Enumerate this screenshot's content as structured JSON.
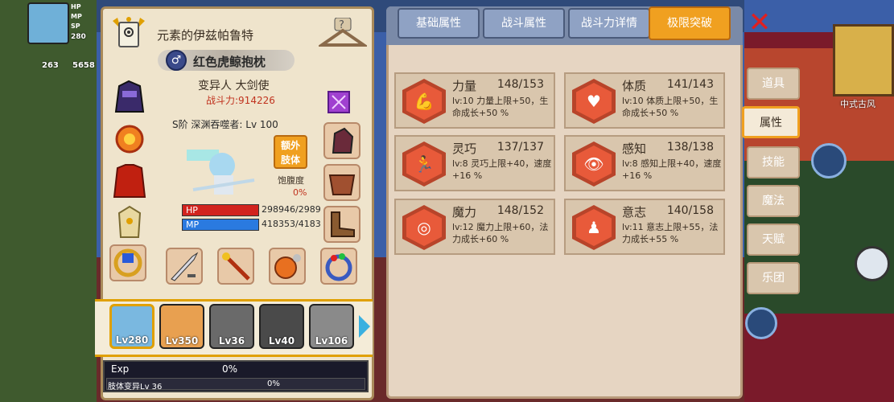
{
  "hud": {
    "hp_label": "HP",
    "mp_label": "MP",
    "sp_label": "SP",
    "level": "280",
    "count1": "263",
    "count2": "5658"
  },
  "header": {
    "title": "元素的伊兹帕鲁特"
  },
  "item": {
    "gender_symbol": "♂",
    "name": "红色虎鲸抱枕"
  },
  "character": {
    "class": "变异人 大剑使",
    "power": "战斗力:914226",
    "rank": "S阶 深渊吞噬者: Lv 100"
  },
  "extra_limb": {
    "label_line1": "额外",
    "label_line2": "肢体"
  },
  "satiety": {
    "label": "饱腹度",
    "value": "0%"
  },
  "bars": {
    "hp_label": "HP",
    "hp_value": "298946/2989",
    "mp_label": "MP",
    "mp_value": "418353/4183"
  },
  "party": [
    {
      "level": "Lv280",
      "selected": true
    },
    {
      "level": "Lv350",
      "selected": false
    },
    {
      "level": "Lv36",
      "selected": false
    },
    {
      "level": "Lv40",
      "selected": false
    },
    {
      "level": "Lv106",
      "selected": false
    }
  ],
  "exp": {
    "label": "Exp",
    "value": "0%",
    "mutation_label": "肢体变异Lv 36",
    "mutation_value": "0%"
  },
  "tabs": [
    {
      "label": "基础属性",
      "active": false
    },
    {
      "label": "战斗属性",
      "active": false
    },
    {
      "label": "战斗力详情",
      "active": false
    },
    {
      "label": "极限突破",
      "active": true
    }
  ],
  "attributes": [
    {
      "name": "力量",
      "value": "148/153",
      "desc": "lv:10 力量上限+50，生命成长+50 %",
      "icon": "strength-icon"
    },
    {
      "name": "体质",
      "value": "141/143",
      "desc": "lv:10 体质上限+50，生命成长+50 %",
      "icon": "constitution-icon"
    },
    {
      "name": "灵巧",
      "value": "137/137",
      "desc": "lv:8 灵巧上限+40，速度+16 %",
      "icon": "agility-icon"
    },
    {
      "name": "感知",
      "value": "138/138",
      "desc": "lv:8 感知上限+40，速度+16 %",
      "icon": "perception-icon"
    },
    {
      "name": "魔力",
      "value": "148/152",
      "desc": "lv:12 魔力上限+60，法力成长+60 %",
      "icon": "magic-icon"
    },
    {
      "name": "意志",
      "value": "140/158",
      "desc": "lv:11 意志上限+55，法力成长+55 %",
      "icon": "will-icon"
    }
  ],
  "side_tabs": [
    {
      "label": "道具",
      "active": false
    },
    {
      "label": "属性",
      "active": true
    },
    {
      "label": "技能",
      "active": false
    },
    {
      "label": "魔法",
      "active": false
    },
    {
      "label": "天赋",
      "active": false
    },
    {
      "label": "乐团",
      "active": false
    }
  ],
  "map": {
    "location": "中式古风"
  }
}
